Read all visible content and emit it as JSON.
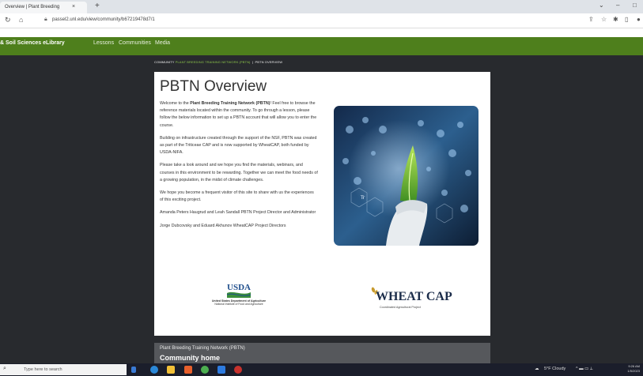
{
  "browser": {
    "tab_title": "Overview | Plant Breeding",
    "tab_close": "×",
    "new_tab": "+",
    "url": "passel2.unl.edu/view/community/b67219478d7/1",
    "window_controls": [
      "⌄",
      "–",
      "□"
    ]
  },
  "site": {
    "brand": "& Soil Sciences eLibrary",
    "nav": [
      "Lessons",
      "Communities",
      "Media"
    ]
  },
  "breadcrumb": {
    "prefix": "COMMUNITY",
    "link": "PLANT BREEDING TRAINING NETWORK (PBTN)",
    "separator": "|",
    "current": "PBTN OVERVIEW"
  },
  "overview": {
    "title": "PBTN Overview",
    "p1_start": "Welcome to the ",
    "p1_bold": "Plant Breeding Training Network (PBTN)",
    "p1_end": "! Feel free to browse the reference materials located within the community. To go through a lesson, please follow the below information to set up a PBTN account that will allow you to enter the course.",
    "p2": "Building on infrastructure created through the support of the NSF, PBTN was created as part of the Triticeae CAP and is now supported by WheatCAP, both funded by USDA-NIFA.",
    "p3": "Please take a look around and we hope you find the materials, webinars, and courses in this environment to be rewarding. Together we can meet the food needs of a growing population, in the midst of climate challenges.",
    "p4": "We hope you become a frequent visitor of this site to share with us the experiences of this exciting project.",
    "p5": "Amanda Peters Haugrud and Leah Sandall PBTN Project Director and Administrator",
    "p6": "Jorge Dubcovsky and Eduard Akhunov WheatCAP Project Directors"
  },
  "logos": {
    "usda_mark": "USDA",
    "usda_line1": "United States Department of Agriculture",
    "usda_line2": "National Institute of Food and Agriculture",
    "wheatcap_title": "WHEAT CAP",
    "wheatcap_sub": "Coordinated Agricultural Project"
  },
  "community_panel": {
    "subtitle": "Plant Breeding Training Network (PBTN)",
    "title": "Community home"
  },
  "taskbar": {
    "search_placeholder": "Type here to search",
    "weather": "5°F Cloudy",
    "time": "9:26 AM",
    "date": "1/5/2023"
  },
  "colors": {
    "site_green": "#4e7f1c",
    "page_dark": "#282a2e",
    "breadcrumb_link": "#8bc34a",
    "usda_blue": "#1f4e8c",
    "usda_green": "#3b8e3a",
    "wheatcap_navy": "#1c2d4a"
  }
}
